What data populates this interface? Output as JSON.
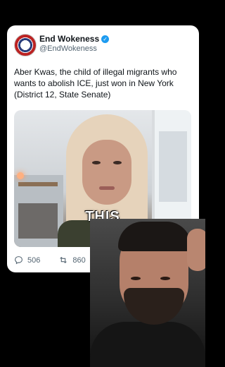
{
  "tweet": {
    "display_name": "End Wokeness",
    "handle": "@EndWokeness",
    "verified_icon": "verified-badge-icon",
    "text": "Aber Kwas, the child of illegal migrants who wants to abolish ICE, just won in New York (District 12, State Senate)"
  },
  "media": {
    "caption": "THIS"
  },
  "actions": {
    "replies": "506",
    "reposts": "860"
  },
  "colors": {
    "verified": "#1d9bf0",
    "text_primary": "#0f1419",
    "text_secondary": "#536471"
  }
}
